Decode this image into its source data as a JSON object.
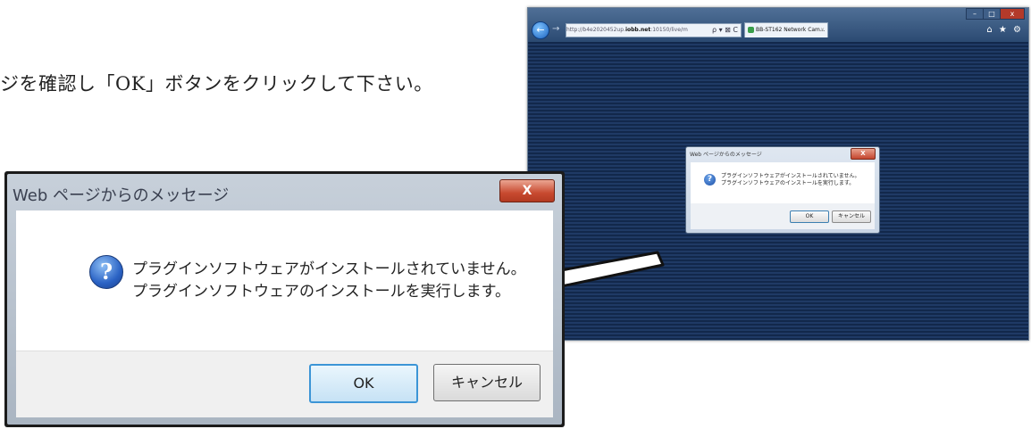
{
  "instruction": "ジを確認し「OK」ボタンをクリックして下さい。",
  "browser": {
    "address_prefix": "http://b4e2020452up.",
    "address_host": "iobb.net",
    "address_rest": ":10150/live/m",
    "address_tools": "ρ ▾ ⊠ C",
    "tab_label": "BB-ST162 Network Cam...",
    "tab_close": "×",
    "toolbar_icons": "⌂ ★ ⚙",
    "window_controls": [
      "–",
      "□",
      "x"
    ]
  },
  "dialog": {
    "title": "Web ページからのメッセージ",
    "close": "X",
    "message_line1": "プラグインソフトウェアがインストールされていません。",
    "message_line2": "プラグインソフトウェアのインストールを実行します。",
    "ok_label": "OK",
    "cancel_label": "キャンセル",
    "icon": "question-icon"
  },
  "colors": {
    "browser_background": "#12284b",
    "ok_border": "#3c95d6",
    "close_button": "#c84a30"
  }
}
